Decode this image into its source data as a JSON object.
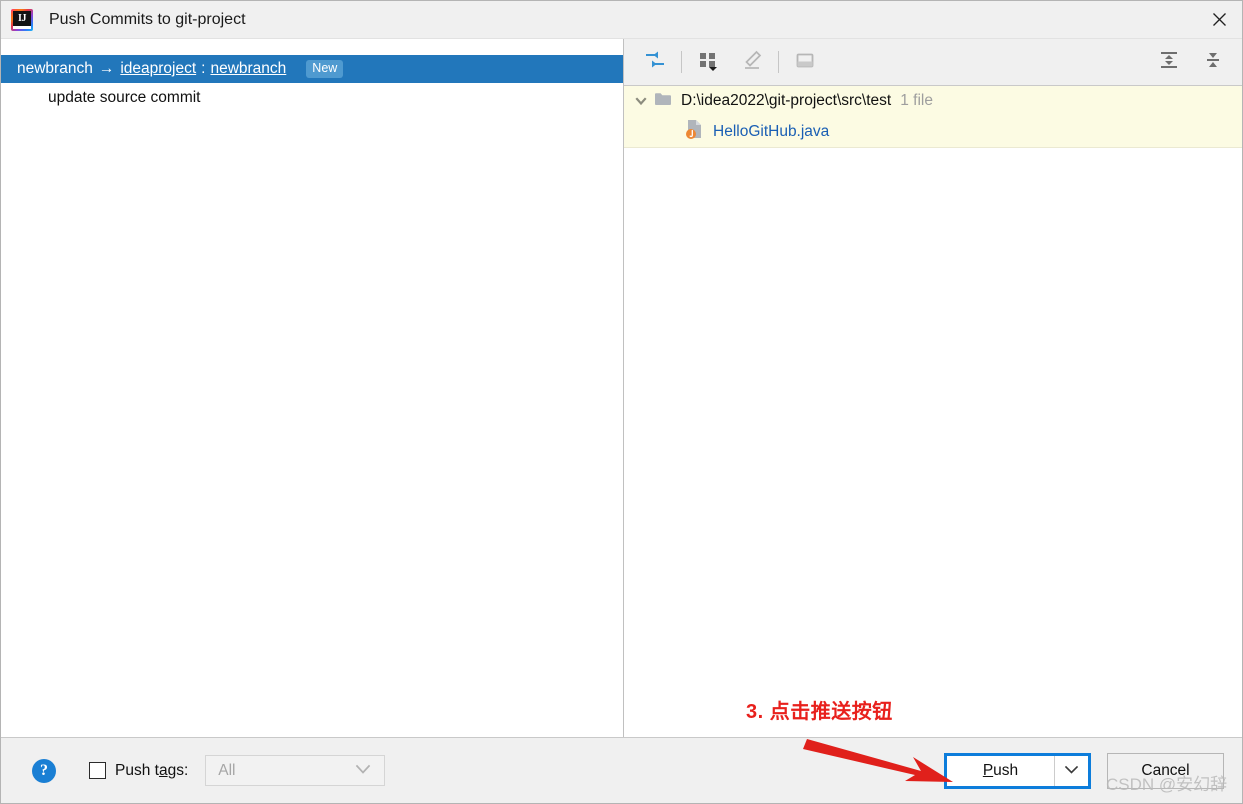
{
  "window": {
    "title": "Push Commits to git-project",
    "app_icon": "intellij-idea-icon",
    "close_icon": "close-icon"
  },
  "commits_panel": {
    "branch_row": {
      "source_branch": "newbranch",
      "arrow": "→",
      "remote": "ideaproject",
      "separator": ":",
      "target_branch": "newbranch",
      "badge": "New"
    },
    "commits": [
      {
        "message": "update source commit"
      }
    ]
  },
  "files_panel": {
    "toolbar": {
      "buttons": [
        {
          "name": "show-diff-icon",
          "tooltip": "Show Diff",
          "enabled": true
        },
        {
          "name": "group-by-icon",
          "tooltip": "Group By",
          "enabled": true
        },
        {
          "name": "edit-source-icon",
          "tooltip": "Edit Source",
          "enabled": false
        },
        {
          "name": "preview-pane-icon",
          "tooltip": "Preview Diff",
          "enabled": false
        },
        {
          "name": "expand-all-icon",
          "tooltip": "Expand All",
          "enabled": true
        },
        {
          "name": "collapse-all-icon",
          "tooltip": "Collapse All",
          "enabled": true
        }
      ]
    },
    "tree": {
      "directory": "D:\\idea2022\\git-project\\src\\test",
      "file_count_label": "1 file",
      "files": [
        {
          "name": "HelloGitHub.java",
          "icon": "java-file-icon",
          "color": "#1a5fb4"
        }
      ]
    }
  },
  "annotation": {
    "text": "3. 点击推送按钮",
    "color": "#e8201c",
    "arrow": "red-arrow-pointing-to-push"
  },
  "bottom_bar": {
    "help_label": "?",
    "push_tags": {
      "checked": false,
      "label_before": "Push t",
      "label_mnemonic": "a",
      "label_after": "gs:",
      "combo_value": "All",
      "combo_enabled": false,
      "chevron": "chevron-down-icon"
    },
    "push_button": {
      "label_before": "",
      "label_mnemonic": "P",
      "label_after": "ush",
      "focused": true,
      "focus_color": "#0d7ddb",
      "dropdown_icon": "chevron-down-icon"
    },
    "cancel_button": {
      "label": "Cancel"
    }
  },
  "watermark": {
    "text": "CSDN @安幻辞"
  }
}
